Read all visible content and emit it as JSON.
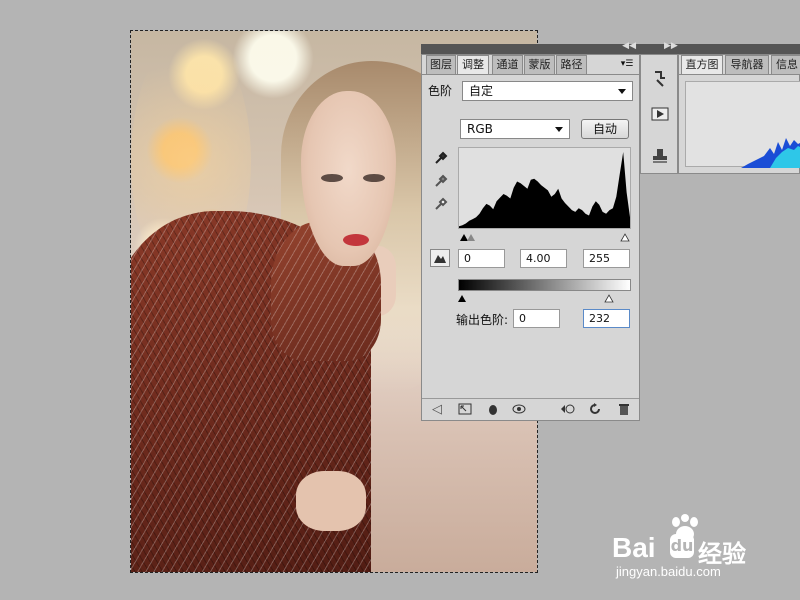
{
  "panel": {
    "tabs": [
      "图层",
      "调整",
      "通道",
      "蒙版",
      "路径"
    ],
    "active_tab": "调整",
    "levels_label": "色阶",
    "preset_value": "自定",
    "channel_value": "RGB",
    "auto_label": "自动",
    "input_levels": {
      "black": "0",
      "gamma": "4.00",
      "white": "255"
    },
    "output_label": "输出色阶:",
    "output_levels": {
      "black": "0",
      "white": "232"
    }
  },
  "right_panel": {
    "tabs": [
      "直方图",
      "导航器",
      "信息"
    ]
  },
  "histogram": [
    2,
    3,
    5,
    8,
    10,
    12,
    16,
    22,
    27,
    25,
    21,
    30,
    34,
    38,
    36,
    33,
    45,
    52,
    50,
    47,
    44,
    54,
    55,
    52,
    48,
    45,
    42,
    35,
    38,
    44,
    33,
    28,
    24,
    20,
    18,
    22,
    20,
    16,
    14,
    24,
    30,
    26,
    18,
    16,
    20,
    22,
    35,
    60,
    85,
    40,
    12
  ],
  "watermark": {
    "brand": "Bai",
    "brand_tail": "经验",
    "url": "jingyan.baidu.com"
  }
}
